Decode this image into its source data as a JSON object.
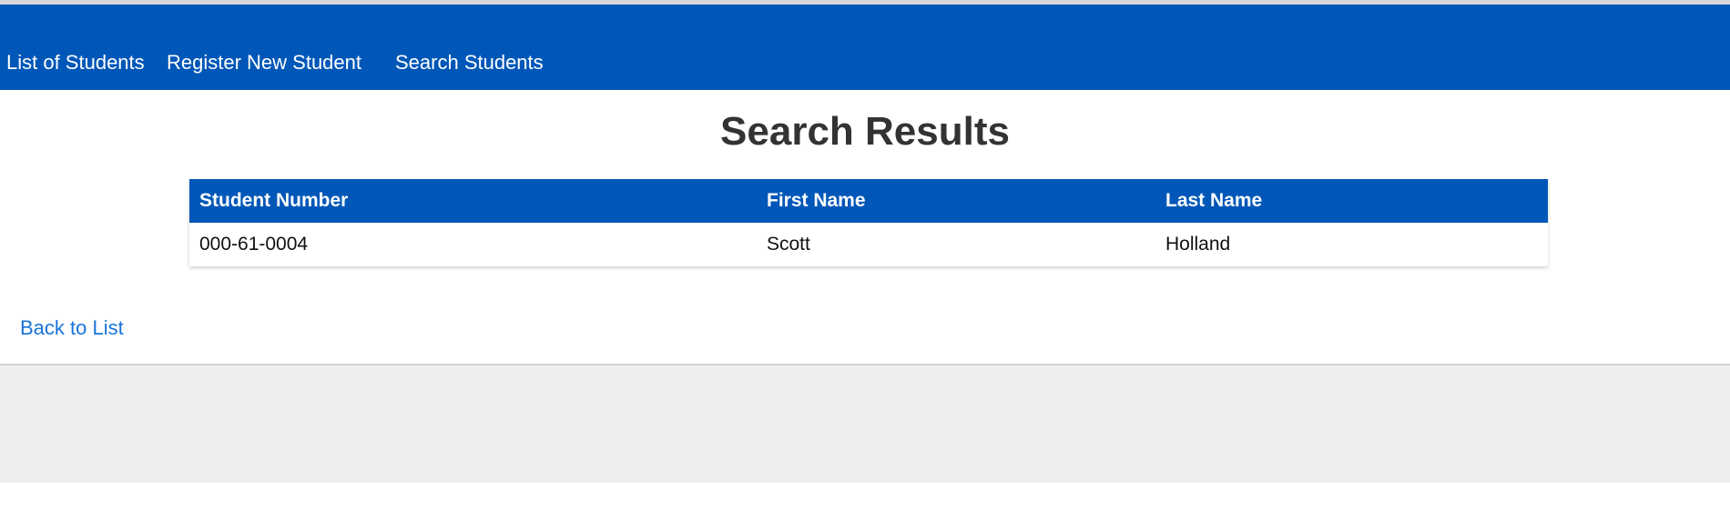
{
  "nav": {
    "items": [
      {
        "label": "List of Students"
      },
      {
        "label": "Register New Student"
      },
      {
        "label": "Search Students"
      }
    ]
  },
  "page": {
    "title": "Search Results"
  },
  "table": {
    "columns": [
      "Student Number",
      "First Name",
      "Last Name"
    ],
    "rows": [
      {
        "student_number": "000-61-0004",
        "first_name": "Scott",
        "last_name": "Holland"
      }
    ]
  },
  "links": {
    "back_label": "Back to List"
  },
  "theme": {
    "brand_color": "#0057b8",
    "link_color": "#1a73d9",
    "footer_color": "#eeeeee"
  }
}
